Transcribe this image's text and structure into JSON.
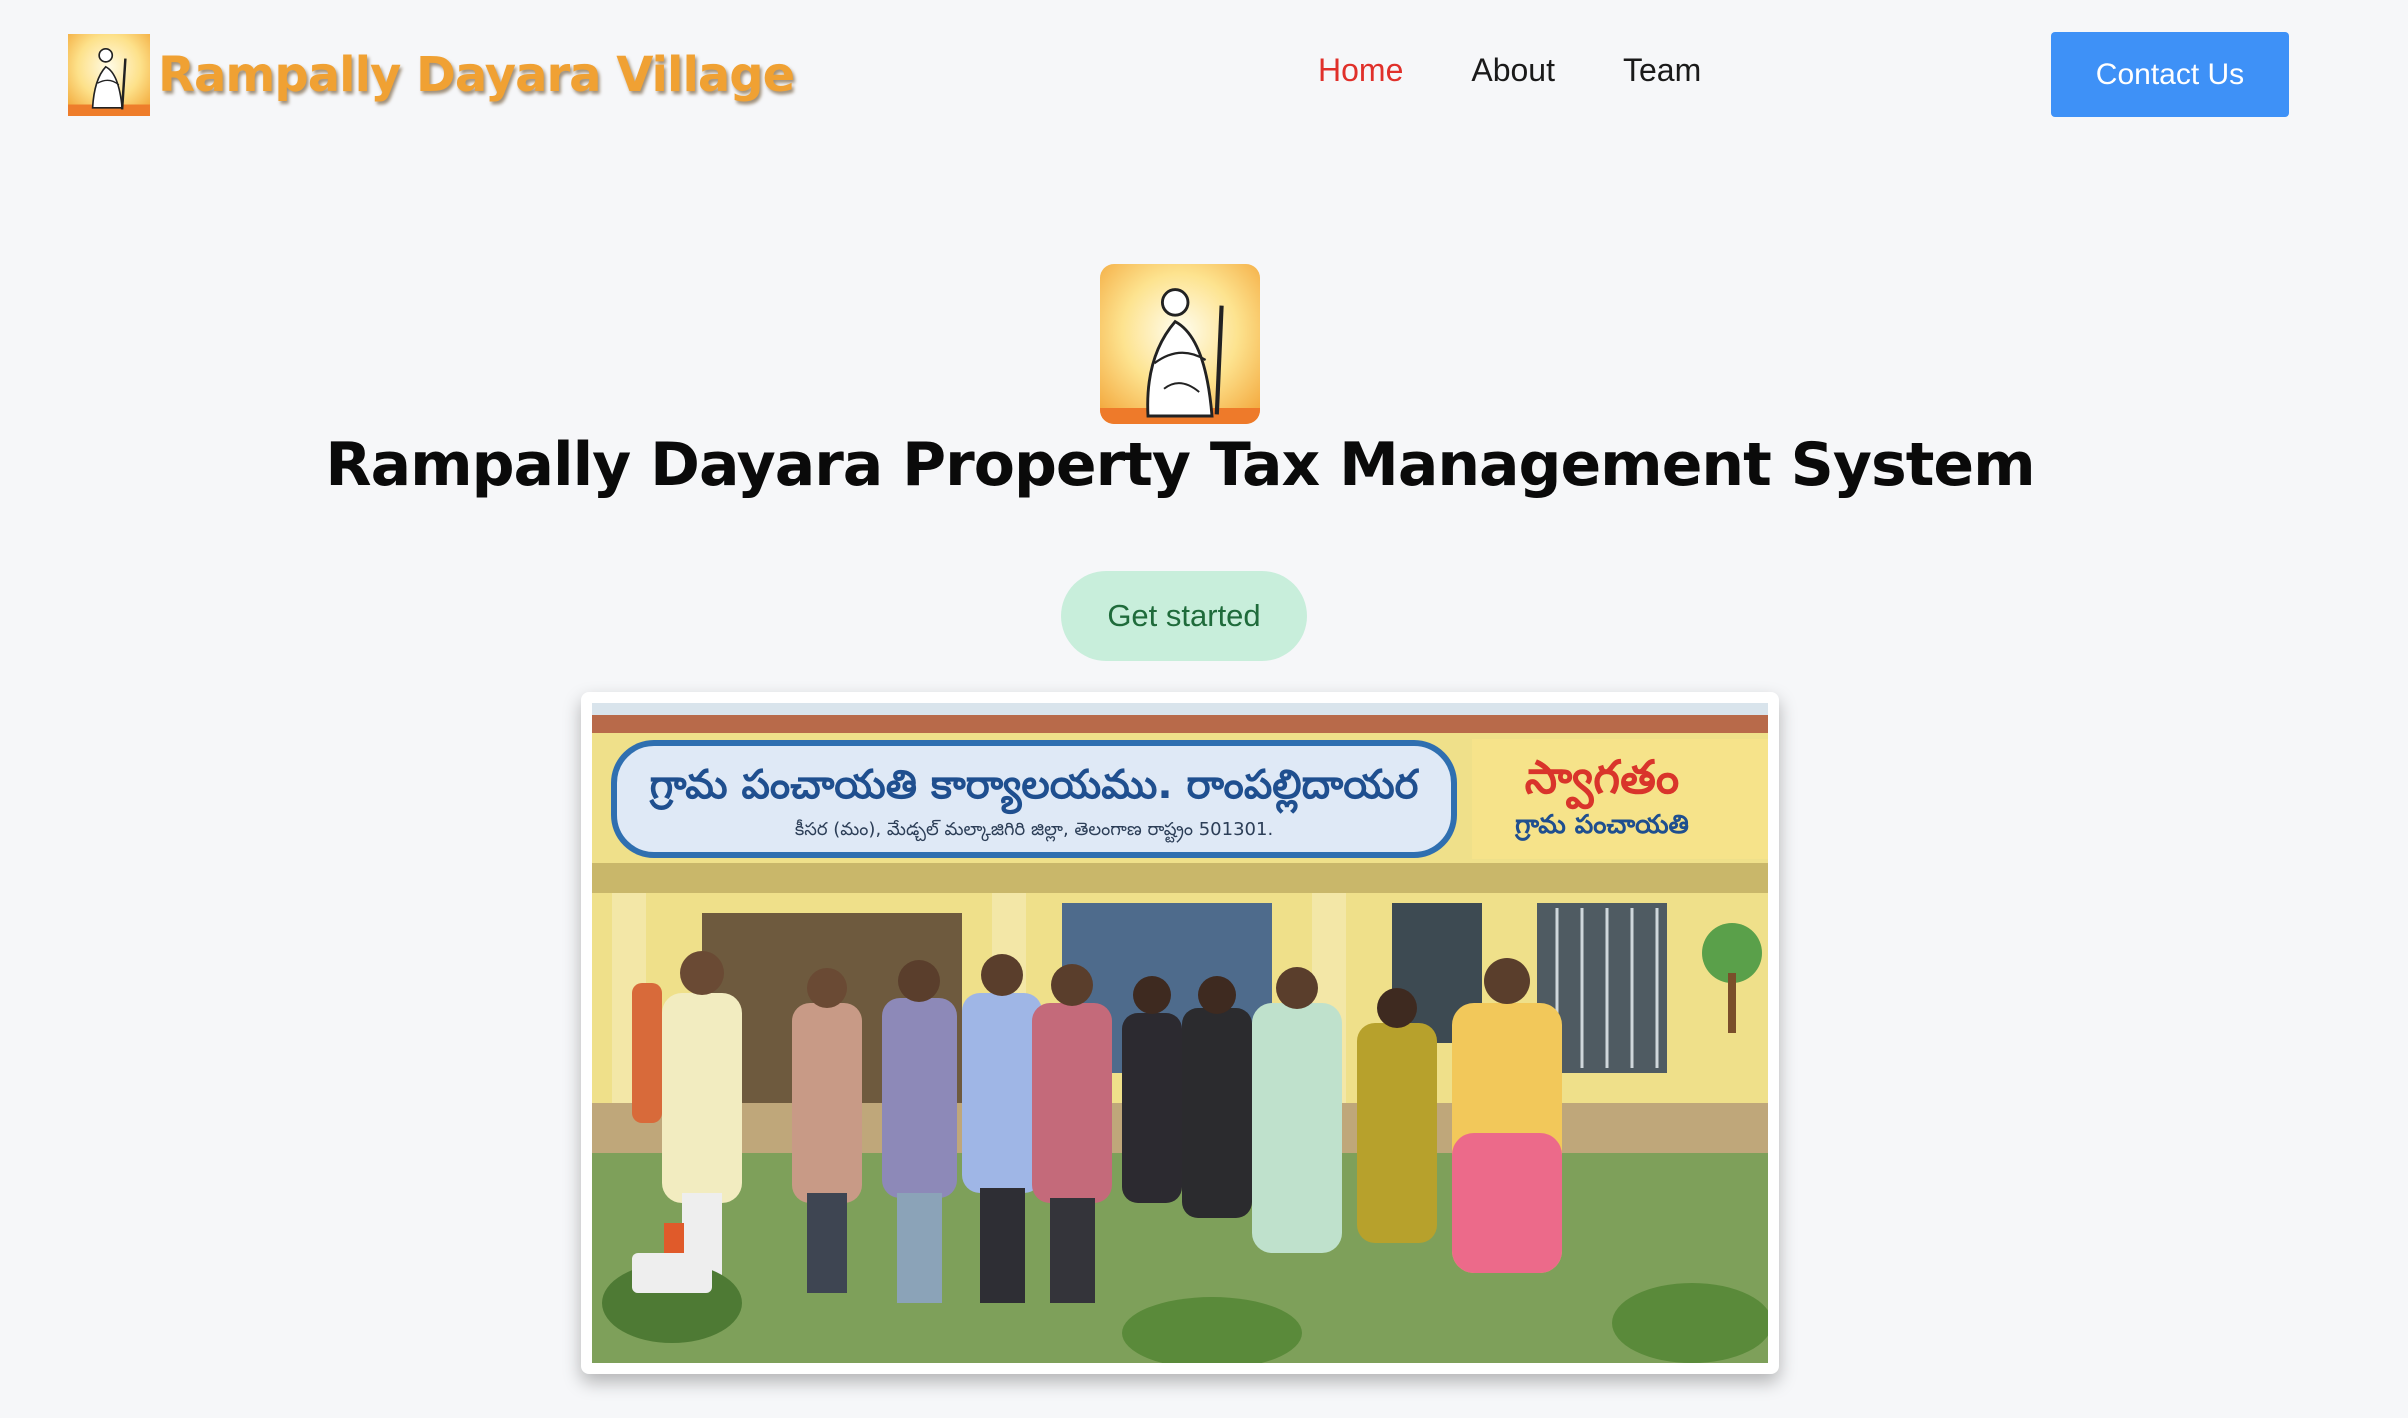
{
  "navbar": {
    "brand_name": "Rampally Dayara Village",
    "links": [
      {
        "label": "Home",
        "active": true
      },
      {
        "label": "About",
        "active": false
      },
      {
        "label": "Team",
        "active": false
      }
    ],
    "contact_label": "Contact Us"
  },
  "hero": {
    "title": "Rampally Dayara Property Tax Management System",
    "cta_label": "Get started"
  },
  "photo": {
    "sign_main": "గ్రామ పంచాయతి కార్యాలయము. రాంపల్లిదాయర",
    "sign_sub": "కీసర (మం), మేడ్చల్ మల్కాజిగిరి జిల్లా, తెలంగాణ రాష్ట్రం 501301.",
    "welcome_main": "స్వాగతం",
    "welcome_sub": "గ్రామ పంచాయతి"
  },
  "colors": {
    "brand": "#f0a133",
    "active_link": "#e0302a",
    "contact_button": "#3e91f7",
    "cta_bg": "#c8eedb",
    "cta_text": "#1f6b3b",
    "page_bg": "#f6f7f9"
  },
  "icons": {
    "brand_logo": "gandhi-logo-icon",
    "hero_logo": "gandhi-logo-icon"
  }
}
